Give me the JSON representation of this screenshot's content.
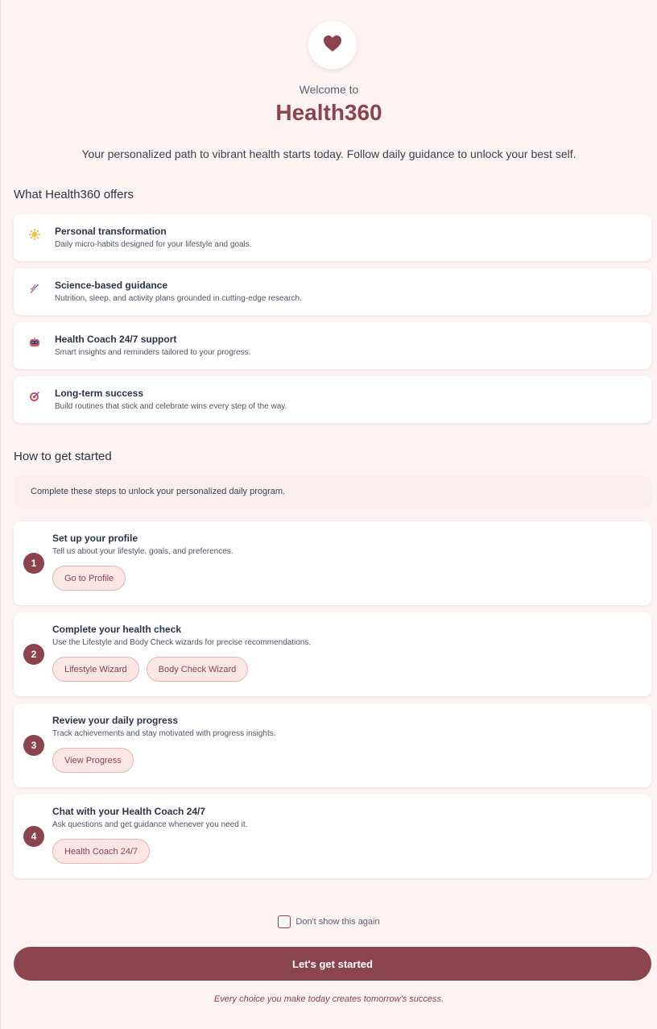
{
  "header": {
    "icon": "heart-icon",
    "welcome": "Welcome to",
    "title": "Health360",
    "tagline": "Your personalized path to vibrant health starts today. Follow daily guidance to unlock your best self."
  },
  "offers": {
    "heading": "What Health360 offers",
    "items": [
      {
        "icon": "sun-icon",
        "title": "Personal transformation",
        "desc": "Daily micro-habits designed for your lifestyle and goals."
      },
      {
        "icon": "dna-icon",
        "title": "Science-based guidance",
        "desc": "Nutrition, sleep, and activity plans grounded in cutting-edge research."
      },
      {
        "icon": "robot-icon",
        "title": "Health Coach 24/7 support",
        "desc": "Smart insights and reminders tailored to your progress."
      },
      {
        "icon": "target-icon",
        "title": "Long-term success",
        "desc": "Build routines that stick and celebrate wins every step of the way."
      }
    ]
  },
  "getting_started": {
    "heading": "How to get started",
    "info": "Complete these steps to unlock your personalized daily program.",
    "steps": [
      {
        "num": "1",
        "title": "Set up your profile",
        "desc": "Tell us about your lifestyle, goals, and preferences.",
        "buttons": [
          "Go to Profile"
        ]
      },
      {
        "num": "2",
        "title": "Complete your health check",
        "desc": "Use the Lifestyle and Body Check wizards for precise recommendations.",
        "buttons": [
          "Lifestyle Wizard",
          "Body Check Wizard"
        ]
      },
      {
        "num": "3",
        "title": "Review your daily progress",
        "desc": "Track achievements and stay motivated with progress insights.",
        "buttons": [
          "View Progress"
        ]
      },
      {
        "num": "4",
        "title": "Chat with your Health Coach 24/7",
        "desc": "Ask questions and get guidance whenever you need it.",
        "buttons": [
          "Health Coach 24/7"
        ]
      }
    ]
  },
  "footer": {
    "checkbox_label": "Don't show this again",
    "checkbox_checked": false,
    "cta": "Let's get started",
    "quote": "Every choice you make today creates tomorrow's success."
  },
  "colors": {
    "accent": "#8b444b",
    "background": "#fdf3f3",
    "pill_bg": "#fbe6e6"
  }
}
